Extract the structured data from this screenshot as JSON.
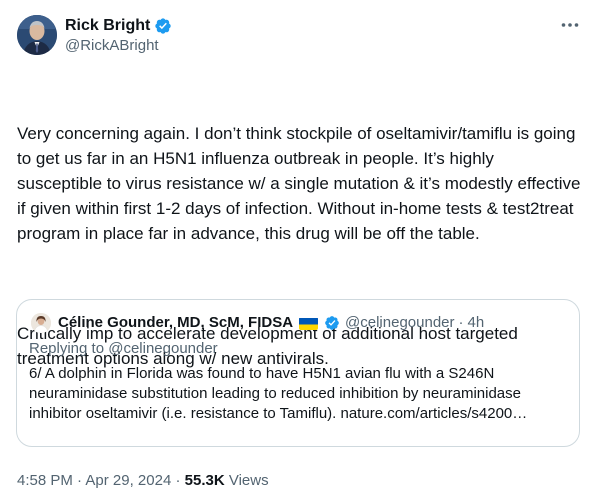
{
  "author": {
    "name": "Rick Bright",
    "handle": "@RickABright"
  },
  "tweet": {
    "paragraph_1": "Very concerning again. I don’t think stockpile of oseltamivir/tamiflu is going to get us far in an H5N1 influenza outbreak in people. It’s highly susceptible to virus resistance w/ a single mutation & it’s modestly effective if given within first 1-2 days of infection. Without in-home tests & test2treat program in place far in advance, this drug will be off the table.",
    "paragraph_2": "Critically imp to accelerate development of additional host targeted treatment options along w/ new antivirals."
  },
  "quote": {
    "name": "Céline Gounder, MD, ScM, FIDSA",
    "handle": "@celinegounder",
    "separator": "·",
    "time": "4h",
    "replying_to": "Replying to @celinegounder",
    "text": "6/ A dolphin in Florida was found to have H5N1 avian flu with a S246N neuraminidase substitution leading to reduced inhibition by neuraminidase inhibitor oseltamivir (i.e. resistance to Tamiflu). nature.com/articles/s4200…"
  },
  "footer": {
    "time": "4:58 PM",
    "separator": "·",
    "date": "Apr 29, 2024",
    "views_count": "55.3K",
    "views_label": "Views"
  },
  "icons": {
    "verified": "verified-badge-icon",
    "more": "more-horizontal-icon",
    "flag": "ukraine-flag-icon"
  },
  "colors": {
    "verified_blue": "#1d9bf0",
    "text_primary": "#0f1419",
    "text_secondary": "#536471",
    "border": "#cfd9de",
    "flag_blue": "#0057b7",
    "flag_yellow": "#ffd700"
  }
}
